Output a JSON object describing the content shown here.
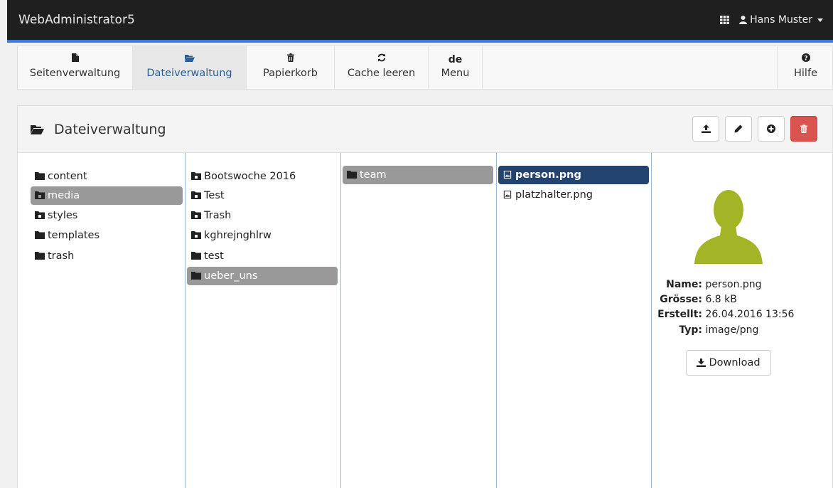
{
  "app": {
    "brand": "WebAdministrator5",
    "user": "Hans Muster"
  },
  "toolbar": {
    "items": [
      {
        "label": "Seitenverwaltung",
        "icon": "file-icon"
      },
      {
        "label": "Dateiverwaltung",
        "icon": "folder-open-icon"
      },
      {
        "label": "Papierkorb",
        "icon": "trash-icon"
      },
      {
        "label": "Cache leeren",
        "icon": "refresh-icon"
      },
      {
        "label": "Menu",
        "icon_text": "de"
      }
    ],
    "help": {
      "label": "Hilfe",
      "icon": "question-icon"
    }
  },
  "panel": {
    "title": "Dateiverwaltung",
    "actions": [
      "upload-icon",
      "pencil-icon",
      "plus-circle-icon",
      "trash-icon"
    ]
  },
  "columns": {
    "c1": [
      "content",
      "media",
      "styles",
      "templates",
      "trash"
    ],
    "c2": [
      "Bootswoche 2016",
      "Test",
      "Trash",
      "kghrejnghlrw",
      "test",
      "ueber_uns"
    ],
    "c3": [
      "team"
    ],
    "c4": [
      "person.png",
      "platzhalter.png"
    ]
  },
  "details": {
    "name_label": "Name:",
    "name": "person.png",
    "size_label": "Grösse:",
    "size": "6.8 kB",
    "created_label": "Erstellt:",
    "created": "26.04.2016 13:56",
    "type_label": "Typ:",
    "type": "image/png",
    "download": "Download"
  },
  "colors": {
    "accent": "#3a7bd5",
    "selected_file": "#22446e",
    "selected_folder": "#999999",
    "danger": "#d9534f",
    "avatar": "#a3b527"
  }
}
